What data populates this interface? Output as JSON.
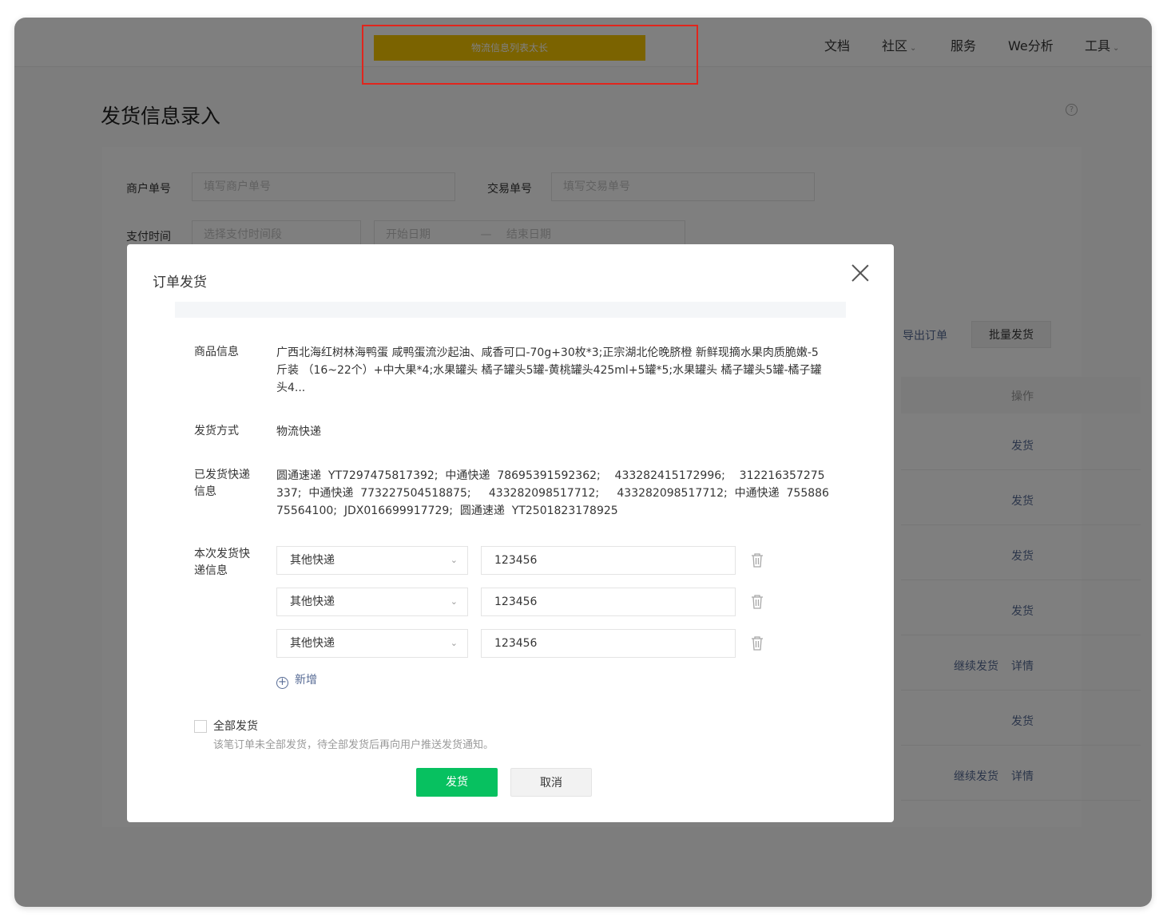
{
  "nav": {
    "notice": "物流信息列表太长",
    "items": [
      "文档",
      "社区",
      "服务",
      "We分析",
      "工具"
    ]
  },
  "page": {
    "title": "发货信息录入"
  },
  "filters": {
    "merchant_no_label": "商户单号",
    "merchant_no_placeholder": "填写商户单号",
    "trade_no_label": "交易单号",
    "trade_no_placeholder": "填写交易单号",
    "pay_time_label": "支付时间",
    "pay_time_placeholder": "选择支付时间段",
    "start_date_placeholder": "开始日期",
    "date_sep": "—",
    "end_date_placeholder": "结束日期"
  },
  "list": {
    "export_label": "导出订单",
    "batch_label": "批量发货",
    "op_header": "操作",
    "rows": [
      {
        "ops": [
          "发货"
        ]
      },
      {
        "ops": [
          "发货"
        ]
      },
      {
        "ops": [
          "发货"
        ]
      },
      {
        "ops": [
          "发货"
        ]
      },
      {
        "ops": [
          "继续发货",
          "详情"
        ]
      },
      {
        "ops": [
          "发货"
        ]
      },
      {
        "ops": [
          "继续发货",
          "详情"
        ]
      }
    ]
  },
  "modal": {
    "title": "订单发货",
    "goods_label": "商品信息",
    "goods_value": "广西北海红树林海鸭蛋 咸鸭蛋流沙起油、咸香可口-70g+30枚*3;正宗湖北伦晚脐橙 新鲜现摘水果肉质脆嫩-5斤装 （16~22个）+中大果*4;水果罐头 橘子罐头5罐-黄桃罐头425ml+5罐*5;水果罐头 橘子罐头5罐-橘子罐头4...",
    "method_label": "发货方式",
    "method_value": "物流快递",
    "shipped_label": "已发货快递信息",
    "shipped_value": "圆通速递  YT7297475817392;  中通快递  78695391592362;    433282415172996;    312216357275337;  中通快递  773227504518875;     433282098517712;     433282098517712;  中通快递  75588675564100;  JDX016699917729;  圆通速递  YT2501823178925",
    "current_label": "本次发货快递信息",
    "entries": [
      {
        "carrier": "其他快递",
        "tracking": "123456"
      },
      {
        "carrier": "其他快递",
        "tracking": "123456"
      },
      {
        "carrier": "其他快递",
        "tracking": "123456"
      }
    ],
    "add_label": "新增",
    "all_ship_label": "全部发货",
    "hint": "该笔订单未全部发货，待全部发货后再向用户推送发货通知。",
    "confirm_label": "发货",
    "cancel_label": "取消"
  },
  "colors": {
    "primary": "#07c160",
    "notice": "#f7c600",
    "highlight_outline": "#e0261d",
    "link": "#576b95"
  }
}
